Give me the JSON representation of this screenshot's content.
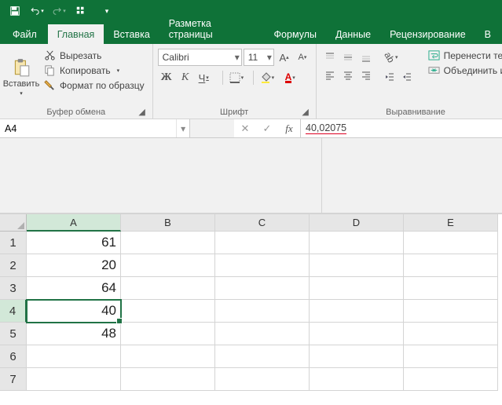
{
  "qat": {
    "save": "save",
    "undo": "undo",
    "redo": "redo",
    "touch": "touch"
  },
  "tabs": {
    "file": "Файл",
    "home": "Главная",
    "insert": "Вставка",
    "layout": "Разметка страницы",
    "formulas": "Формулы",
    "data": "Данные",
    "review": "Рецензирование",
    "view": "В"
  },
  "ribbon": {
    "clipboard": {
      "paste": "Вставить",
      "cut": "Вырезать",
      "copy": "Копировать",
      "format_painter": "Формат по образцу",
      "group_label": "Буфер обмена"
    },
    "font": {
      "name": "Calibri",
      "size": "11",
      "bold": "Ж",
      "italic": "К",
      "underline": "Ч",
      "group_label": "Шрифт"
    },
    "alignment": {
      "wrap": "Перенести тек",
      "merge": "Объединить и",
      "group_label": "Выравнивание"
    }
  },
  "formula_bar": {
    "cell_ref": "A4",
    "value": "40,02075"
  },
  "grid": {
    "columns": [
      "A",
      "B",
      "C",
      "D",
      "E"
    ],
    "rows": [
      "1",
      "2",
      "3",
      "4",
      "5",
      "6",
      "7"
    ],
    "active_col": "A",
    "active_row": "4",
    "data": {
      "A": {
        "1": "61",
        "2": "20",
        "3": "64",
        "4": "40",
        "5": "48"
      }
    }
  },
  "chart_data": {
    "type": "table",
    "columns": [
      "A"
    ],
    "rows": [
      {
        "row": 1,
        "A": 61
      },
      {
        "row": 2,
        "A": 20
      },
      {
        "row": 3,
        "A": 64
      },
      {
        "row": 4,
        "A": 40
      },
      {
        "row": 5,
        "A": 48
      }
    ],
    "active_cell": {
      "ref": "A4",
      "raw_value": "40,02075",
      "display_value": 40
    }
  }
}
